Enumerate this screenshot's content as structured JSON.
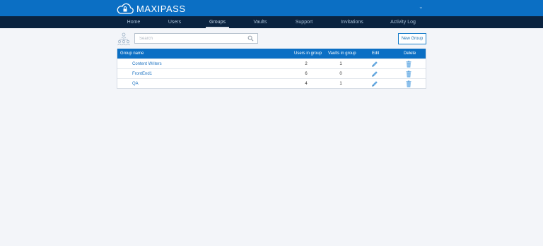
{
  "header": {
    "logo_text": "MAXIPASS"
  },
  "nav": {
    "items": [
      {
        "label": "Home"
      },
      {
        "label": "Users"
      },
      {
        "label": "Groups"
      },
      {
        "label": "Vaults"
      },
      {
        "label": "Support"
      },
      {
        "label": "Invitations"
      },
      {
        "label": "Activity Log"
      }
    ],
    "active": "Groups"
  },
  "toolbar": {
    "search_placeholder": "Search",
    "new_group_label": "New Group"
  },
  "table": {
    "columns": [
      "Group name",
      "Users in group",
      "Vaults in group",
      "Edit",
      "Delete"
    ],
    "rows": [
      {
        "name": "Content Writers",
        "users": "2",
        "vaults": "1"
      },
      {
        "name": "FrontEnd1",
        "users": "6",
        "vaults": "0"
      },
      {
        "name": "QA",
        "users": "4",
        "vaults": "1"
      }
    ]
  },
  "colors": {
    "header_blue": "#0b6fc4",
    "nav_dark": "#0a2340",
    "link_blue": "#1b72c2",
    "background": "#f3f5f9"
  },
  "icons": [
    "cloud-lock-icon",
    "chevron-down-icon",
    "group-icon",
    "search-icon",
    "pencil-icon",
    "trash-icon"
  ]
}
